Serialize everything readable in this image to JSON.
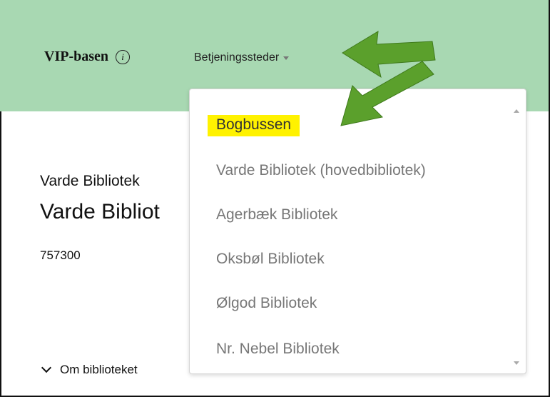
{
  "header": {
    "brand": "VIP-basen",
    "info_icon": "i",
    "nav_dropdown": "Betjeningssteder"
  },
  "content": {
    "subtitle": "Varde Bibliotek",
    "title": "Varde Bibliot",
    "id": "757300",
    "about_link": "Om biblioteket"
  },
  "menu": {
    "items": [
      "Bogbussen",
      "Varde Bibliotek (hovedbibliotek)",
      "Agerbæk Bibliotek",
      "Oksbøl Bibliotek",
      "Ølgod Bibliotek",
      "Nr. Nebel Bibliotek"
    ]
  },
  "colors": {
    "topbar": "#a8d8b2",
    "highlight": "#fff200",
    "arrow": "#5ba02c"
  }
}
